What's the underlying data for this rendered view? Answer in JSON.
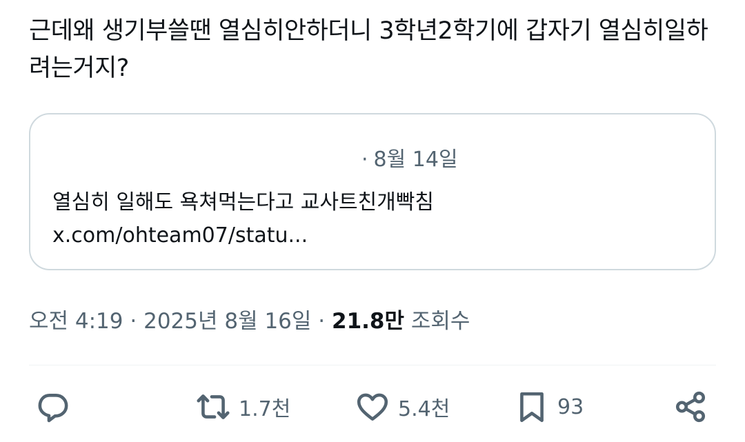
{
  "tweet": {
    "text": "근데왜 생기부쓸땐 열심히안하더니 3학년2학기에 갑자기 열심히일하려는거지?"
  },
  "quote": {
    "date": "8월 14일",
    "text": "열심히 일해도 욕쳐먹는다고 교사트친개빡침",
    "link": "x.com/ohteam07/statu..."
  },
  "meta": {
    "time": "오전 4:19",
    "date": "2025년 8월 16일",
    "views_count": "21.8만",
    "views_label": "조회수"
  },
  "actions": {
    "reply_icon": "reply-icon",
    "retweet_icon": "retweet-icon",
    "retweet_count": "1.7천",
    "like_icon": "heart-icon",
    "like_count": "5.4천",
    "bookmark_icon": "bookmark-icon",
    "bookmark_count": "93",
    "share_icon": "share-icon"
  },
  "colors": {
    "text_primary": "#0f1419",
    "text_secondary": "#536471",
    "border": "#cfd9de"
  }
}
